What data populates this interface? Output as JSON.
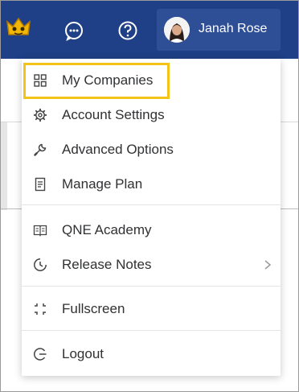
{
  "header": {
    "user_name": "Janah Rose",
    "icons": [
      "app-logo-icon",
      "chat-icon",
      "help-icon"
    ]
  },
  "menu": {
    "items": [
      {
        "label": "My Companies",
        "icon": "grid-icon",
        "highlighted": true
      },
      {
        "label": "Account Settings",
        "icon": "gear-icon"
      },
      {
        "label": "Advanced Options",
        "icon": "wrench-icon"
      },
      {
        "label": "Manage Plan",
        "icon": "document-icon"
      },
      {
        "label": "QNE Academy",
        "icon": "book-icon"
      },
      {
        "label": "Release Notes",
        "icon": "clock-icon",
        "submenu": true
      },
      {
        "label": "Fullscreen",
        "icon": "fullscreen-icon"
      },
      {
        "label": "Logout",
        "icon": "logout-icon"
      }
    ]
  },
  "colors": {
    "header_bg": "#1f3f86",
    "user_chip_bg": "#2e4f96",
    "highlight_border": "#f3c318",
    "menu_text": "#303133"
  }
}
